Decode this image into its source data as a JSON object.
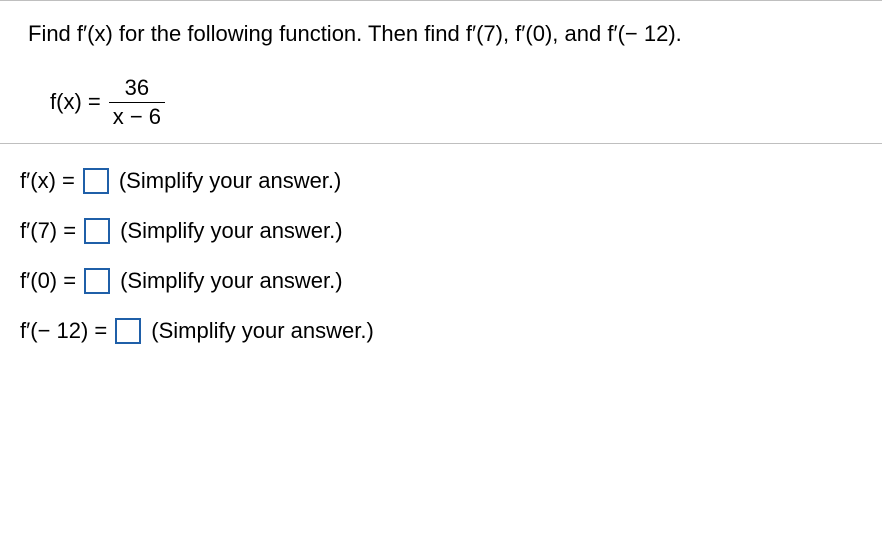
{
  "problem": {
    "prompt": "Find f′(x) for the following function. Then find f′(7), f′(0), and f′(− 12).",
    "function_label": "f(x) =",
    "numerator": "36",
    "denominator": "x − 6"
  },
  "answers": [
    {
      "label": "f′(x) =",
      "hint": "(Simplify your answer.)"
    },
    {
      "label": "f′(7) =",
      "hint": "(Simplify your answer.)"
    },
    {
      "label": "f′(0) =",
      "hint": "(Simplify your answer.)"
    },
    {
      "label": "f′(− 12) =",
      "hint": "(Simplify your answer.)"
    }
  ]
}
